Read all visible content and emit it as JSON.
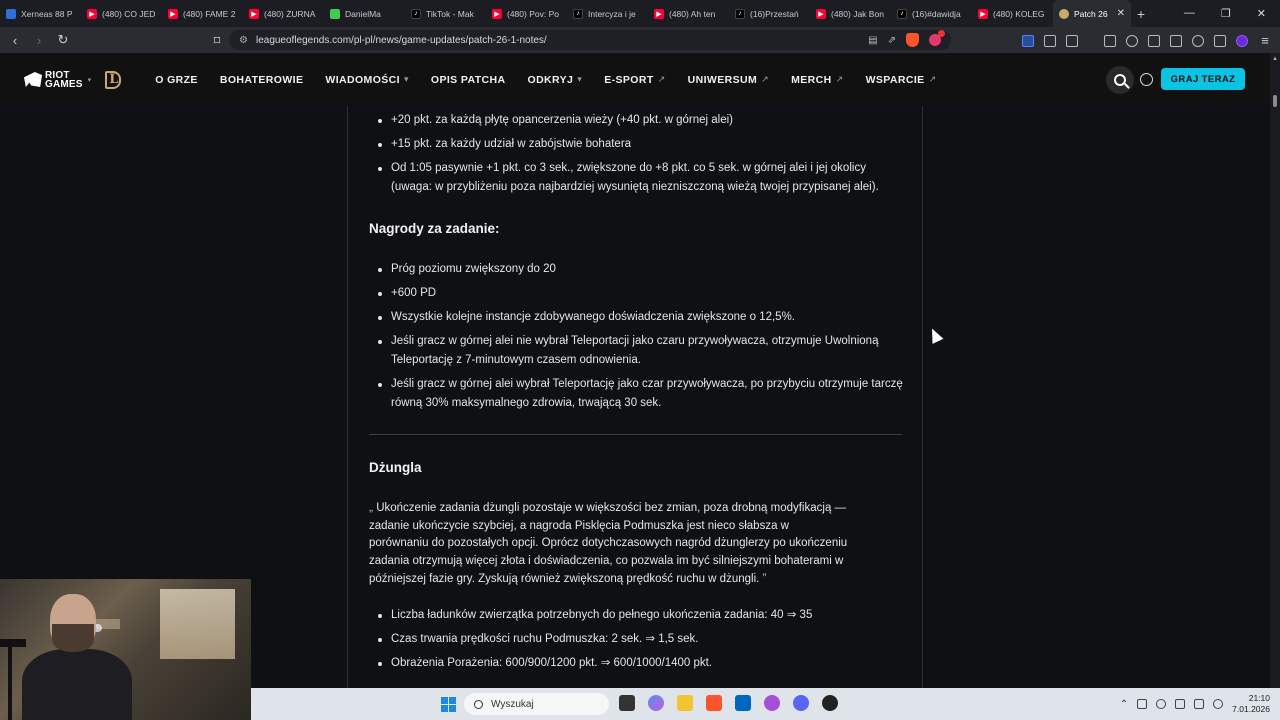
{
  "browser": {
    "tabs": [
      {
        "label": "Xerneas 88 P",
        "icon": "pokemon-icon",
        "kind": "pk"
      },
      {
        "label": "(480) CO JED",
        "icon": "youtube-icon",
        "kind": "yt"
      },
      {
        "label": "(480) FAME 2",
        "icon": "youtube-icon",
        "kind": "yt"
      },
      {
        "label": "(480) ŻURNA",
        "icon": "youtube-icon",
        "kind": "yt"
      },
      {
        "label": "DanielMa",
        "icon": "kick-icon",
        "kind": "gr"
      },
      {
        "label": "TikTok - Mak",
        "icon": "tiktok-icon",
        "kind": "tt"
      },
      {
        "label": "(480) Pov: Po",
        "icon": "youtube-icon",
        "kind": "yt"
      },
      {
        "label": "Intercyza i je",
        "icon": "tiktok-icon",
        "kind": "tt"
      },
      {
        "label": "(480) Ah ten",
        "icon": "youtube-icon",
        "kind": "yt"
      },
      {
        "label": "(16)Przestań",
        "icon": "tiktok-icon",
        "kind": "tt"
      },
      {
        "label": "(480) Jak Bon",
        "icon": "youtube-icon",
        "kind": "yt"
      },
      {
        "label": "(16)#dawidja",
        "icon": "tiktok-icon",
        "kind": "tt"
      },
      {
        "label": "(480) KOLEG",
        "icon": "youtube-icon",
        "kind": "yt"
      },
      {
        "label": "Patch 26",
        "icon": "league-icon",
        "kind": "lol",
        "active": true
      }
    ],
    "url": "leagueoflegends.com/pl-pl/news/game-updates/patch-26-1-notes/"
  },
  "site": {
    "brand_line1": "RIOT",
    "brand_line2": "GAMES",
    "nav": [
      {
        "label": "O GRZE",
        "suffix": ""
      },
      {
        "label": "BOHATEROWIE",
        "suffix": ""
      },
      {
        "label": "WIADOMOŚCI",
        "suffix": "▾"
      },
      {
        "label": "OPIS PATCHA",
        "suffix": ""
      },
      {
        "label": "ODKRYJ",
        "suffix": "▾"
      },
      {
        "label": "E-SPORT",
        "suffix": "↗"
      },
      {
        "label": "UNIWERSUM",
        "suffix": "↗"
      },
      {
        "label": "MERCH",
        "suffix": "↗"
      },
      {
        "label": "WSPARCIE",
        "suffix": "↗"
      }
    ],
    "play_label": "GRAJ TERAZ"
  },
  "article": {
    "list1": [
      "+20 pkt. za każdą płytę opancerzenia wieży (+40 pkt. w górnej alei)",
      "+15 pkt. za każdy udział w zabójstwie bohatera",
      "Od 1:05 pasywnie +1 pkt. co 3 sek., zwiększone do +8 pkt. co 5 sek. w górnej alei i jej okolicy (uwaga: w przybliżeniu poza najbardziej wysuniętą niezniszczoną wieżą twojej przypisanej alei)."
    ],
    "heading1": "Nagrody za zadanie:",
    "list2": [
      "Próg poziomu zwiększony do 20",
      "+600 PD",
      "Wszystkie kolejne instancje zdobywanego doświadczenia zwiększone o 12,5%.",
      "Jeśli gracz w górnej alei nie wybrał Teleportacji jako czaru przywoływacza, otrzymuje Uwolnioną Teleportację z 7-minutowym czasem odnowienia.",
      "Jeśli gracz w górnej alei wybrał Teleportację jako czar przywoływacza, po przybyciu otrzymuje tarczę równą 30% maksymalnego zdrowia, trwającą 30 sek."
    ],
    "heading2": "Dżungla",
    "quote": "Ukończenie zadania dżungli pozostaje w większości bez zmian, poza drobną modyfikacją — zadanie ukończycie szybciej, a nagroda Pisklęcia Podmuszka jest nieco słabsza w porównaniu do pozostałych opcji. Oprócz dotychczasowych nagród dżunglerzy po ukończeniu zadania otrzymują więcej złota i doświadczenia, co pozwala im być silniejszymi bohaterami w późniejszej fazie gry. Zyskują również zwiększoną prędkość ruchu w dżungli.",
    "quote_open": "„",
    "quote_close": "”",
    "list3": [
      "Liczba ładunków zwierzątka potrzebnych do pełnego ukończenia zadania: 40 ⇒ 35",
      "Czas trwania prędkości ruchu Podmuszka: 2 sek. ⇒ 1,5 sek.",
      "Obrażenia Porażenia: 600/900/1200 pkt. ⇒ 600/1000/1400 pkt."
    ]
  },
  "taskbar": {
    "search_placeholder": "Wyszukaj",
    "time": "21:10",
    "date": "7.01.2026"
  }
}
